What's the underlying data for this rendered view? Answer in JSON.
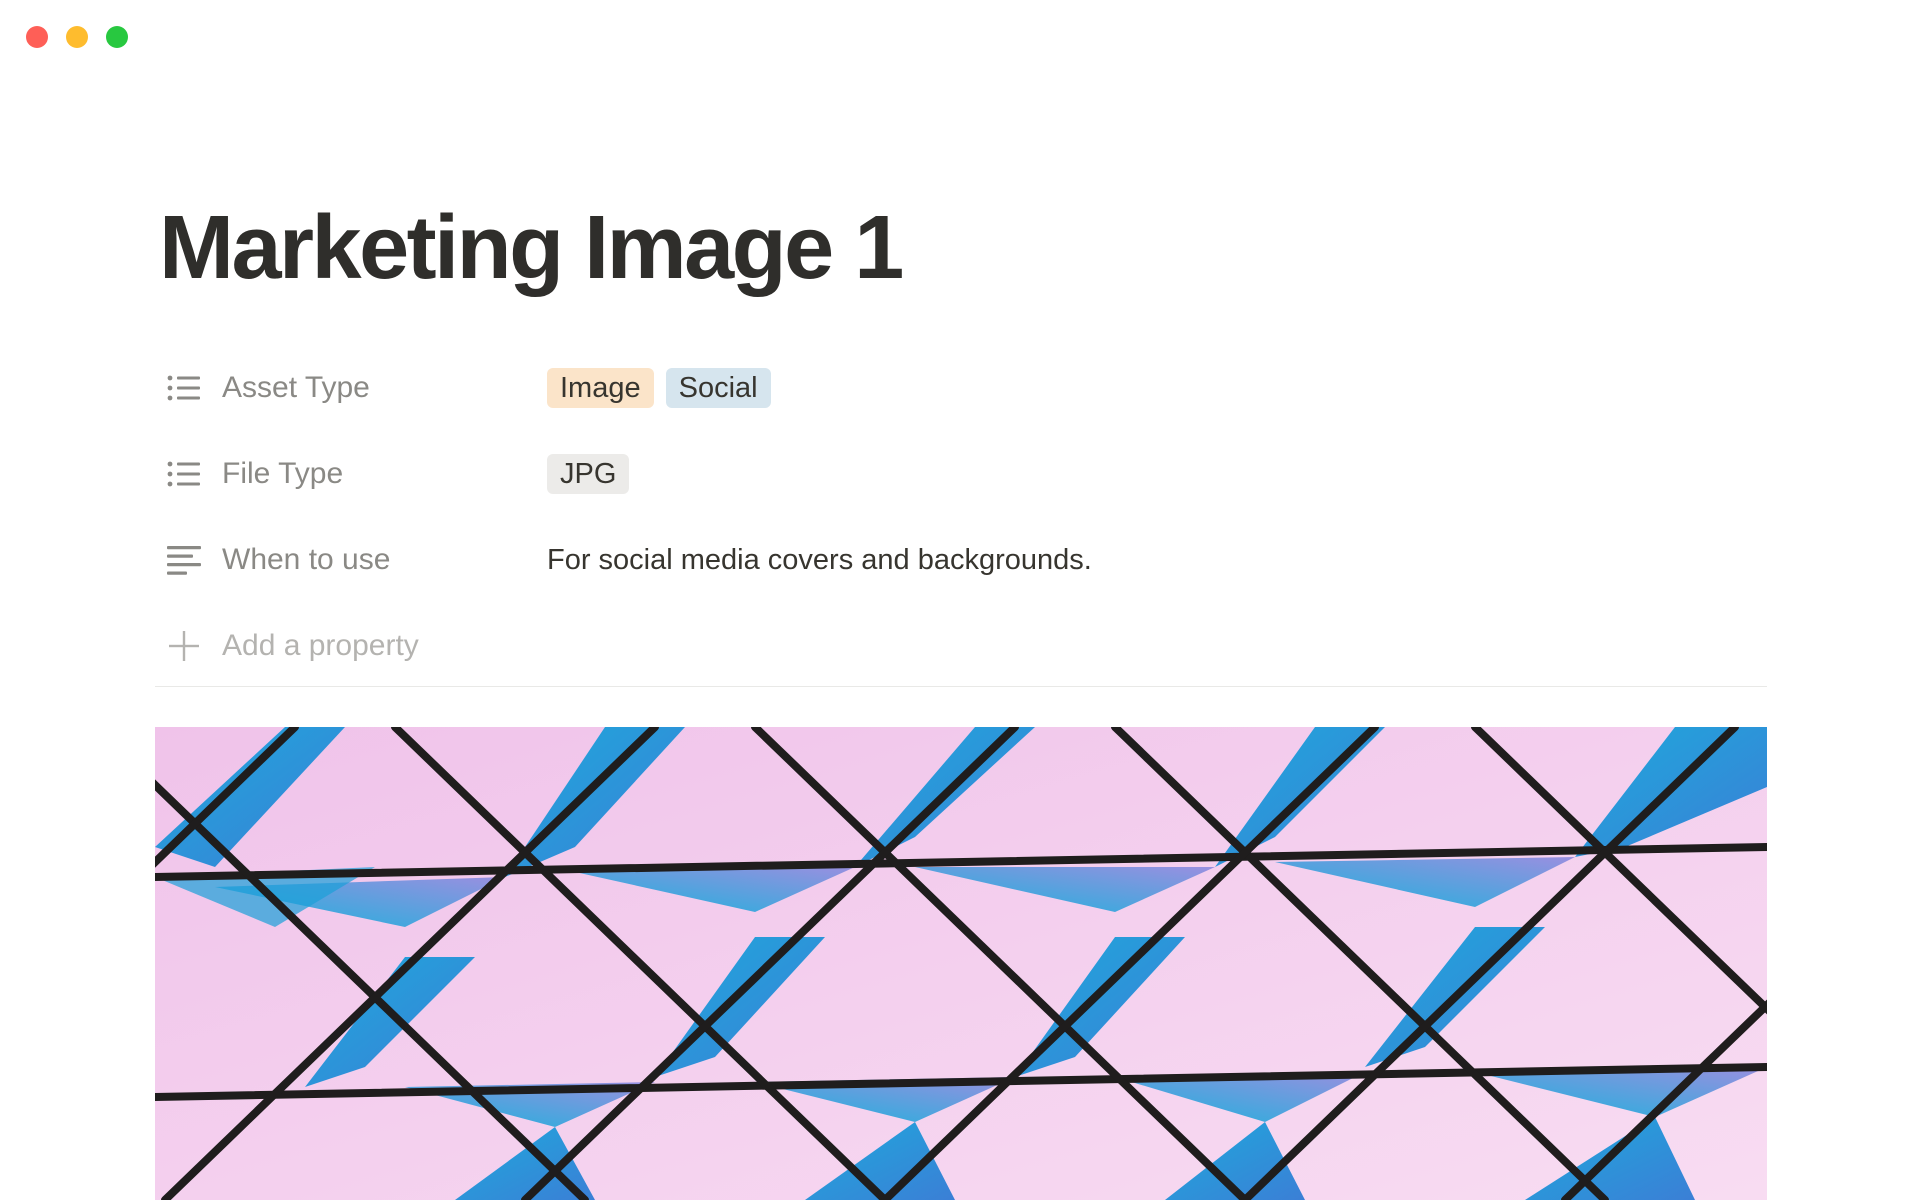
{
  "window": {
    "controls": [
      "close",
      "minimize",
      "zoom"
    ],
    "colors": {
      "close": "#fe5f57",
      "minimize": "#febc2e",
      "zoom": "#28c840"
    }
  },
  "page": {
    "title": "Marketing Image 1"
  },
  "properties": [
    {
      "icon": "list-icon",
      "label": "Asset Type",
      "tags": [
        {
          "text": "Image",
          "color": "#fbe4c9"
        },
        {
          "text": "Social",
          "color": "#d6e5ee"
        }
      ]
    },
    {
      "icon": "list-icon",
      "label": "File Type",
      "tags": [
        {
          "text": "JPG",
          "color": "#ecebe9"
        }
      ]
    },
    {
      "icon": "text-lines-icon",
      "label": "When to use",
      "text": "For social media covers and backgrounds."
    }
  ],
  "add_property": {
    "icon": "plus-icon",
    "label": "Add a property"
  },
  "cover": {
    "icon": "geometric-pattern-image",
    "colors": {
      "pink": "#f3c9ec",
      "blue": "#1aa7d9",
      "line": "#1f1d1d"
    }
  }
}
